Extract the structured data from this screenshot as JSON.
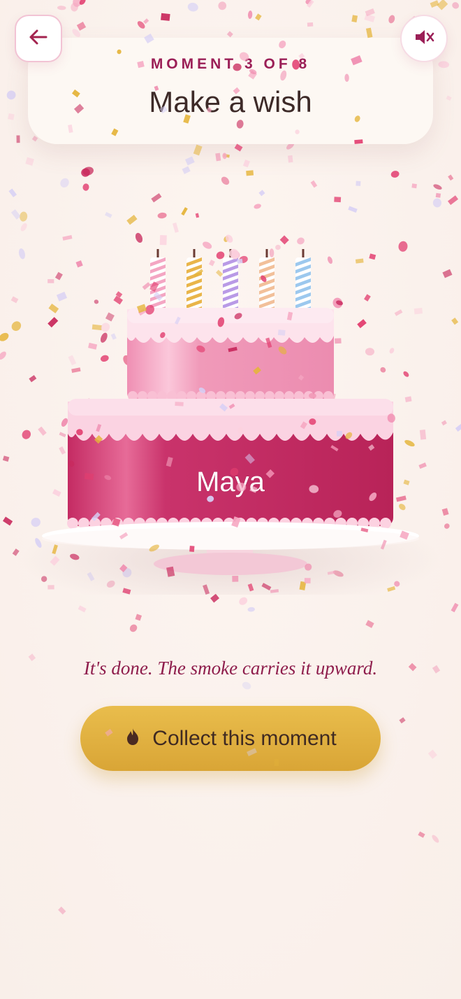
{
  "header": {
    "back_icon": "arrow-left-icon",
    "mute_icon": "speaker-muted-icon"
  },
  "card": {
    "moment_label": "MOMENT 3 OF 8",
    "title": "Make a wish"
  },
  "cake": {
    "name": "Maya",
    "candle_count": 5,
    "candle_colors": [
      "#f4a6c3",
      "#e9b54a",
      "#b99ae6",
      "#f2c09a",
      "#9cc8ee"
    ]
  },
  "caption": "It's done. The smoke carries it upward.",
  "cta": {
    "label": "Collect this moment",
    "icon": "flame-icon"
  },
  "colors": {
    "accent_pink": "#9b1f57",
    "button_gold": "#e2b142",
    "background": "#fbf3ee"
  }
}
